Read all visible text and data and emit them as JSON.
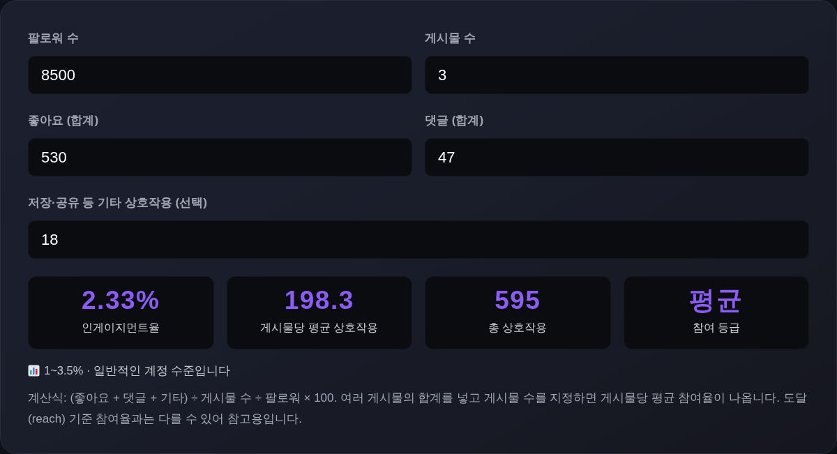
{
  "fields": [
    {
      "label": "팔로워 수",
      "value": "8500",
      "wide": false
    },
    {
      "label": "게시물 수",
      "value": "3",
      "wide": false
    },
    {
      "label": "좋아요 (합계)",
      "value": "530",
      "wide": false
    },
    {
      "label": "댓글 (합계)",
      "value": "47",
      "wide": false
    },
    {
      "label": "저장·공유 등 기타 상호작용 (선택)",
      "value": "18",
      "wide": true
    }
  ],
  "stats": [
    {
      "value": "2.33%",
      "label": "인게이지먼트율"
    },
    {
      "value": "198.3",
      "label": "게시물당 평균 상호작용"
    },
    {
      "value": "595",
      "label": "총 상호작용"
    },
    {
      "value": "평균",
      "label": "참여 등급"
    }
  ],
  "verdict": "1~3.5% · 일반적인 계정 수준입니다",
  "formula": "계산식: (좋아요 + 댓글 + 기타) ÷ 게시물 수 ÷ 팔로워 × 100. 여러 게시물의 합계를 넣고 게시물 수를 지정하면 게시물당 평균 참여율이 나옵니다. 도달 (reach) 기준 참여율과는 다를 수 있어 참고용입니다."
}
